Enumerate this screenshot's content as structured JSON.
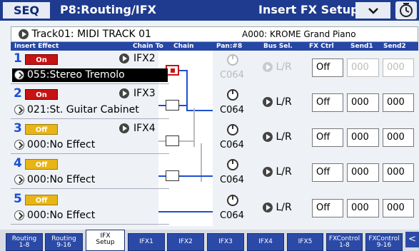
{
  "header": {
    "mode": "SEQ",
    "page_title": "P8:Routing/IFX",
    "page_menu": "Insert FX Setup",
    "menu_icon": "chevron-down-icon",
    "clock_icon": "clock-icon"
  },
  "track": {
    "name": "Track01: MIDI TRACK 01",
    "program": "A000: KROME Grand Piano"
  },
  "columns": {
    "insert_effect": "Insert Effect",
    "chain_to": "Chain To",
    "chain": "Chain",
    "pan": "Pan:#8",
    "bus_sel": "Bus Sel.",
    "fx_ctrl": "FX Ctrl",
    "send1": "Send1",
    "send2": "Send2"
  },
  "ifx_slots": [
    {
      "number": "1",
      "on_label": "On",
      "chain_to": "IFX2",
      "effect": "055:Stereo Tremolo",
      "pan": "C064",
      "bus": "L/R",
      "fx_ctrl": "Off",
      "send1": "000",
      "send2": "000"
    },
    {
      "number": "2",
      "on_label": "On",
      "chain_to": "IFX3",
      "effect": "021:St. Guitar Cabinet",
      "pan": "C064",
      "bus": "L/R",
      "fx_ctrl": "Off",
      "send1": "000",
      "send2": "000"
    },
    {
      "number": "3",
      "on_label": "Off",
      "chain_to": "IFX4",
      "effect": "000:No Effect",
      "pan": "C064",
      "bus": "L/R",
      "fx_ctrl": "Off",
      "send1": "000",
      "send2": "000"
    },
    {
      "number": "4",
      "on_label": "Off",
      "chain_to": "",
      "effect": "000:No Effect",
      "pan": "C064",
      "bus": "L/R",
      "fx_ctrl": "Off",
      "send1": "000",
      "send2": "000"
    },
    {
      "number": "5",
      "on_label": "Off",
      "chain_to": "",
      "effect": "000:No Effect",
      "pan": "C064",
      "bus": "L/R",
      "fx_ctrl": "Off",
      "send1": "000",
      "send2": "000"
    }
  ],
  "tabs": [
    {
      "line1": "Routing",
      "line2": "1-8"
    },
    {
      "line1": "Routing",
      "line2": "9-16"
    },
    {
      "line1": "IFX",
      "line2": "Setup"
    },
    {
      "line1": "IFX1",
      "line2": ""
    },
    {
      "line1": "IFX2",
      "line2": ""
    },
    {
      "line1": "IFX3",
      "line2": ""
    },
    {
      "line1": "IFX4",
      "line2": ""
    },
    {
      "line1": "IFX5",
      "line2": ""
    },
    {
      "line1": "FXControl",
      "line2": "1-8"
    },
    {
      "line1": "FXControl",
      "line2": "9-16"
    }
  ],
  "colors": {
    "title_bar": "#1f3b8f",
    "on_button": "#c61414",
    "off_button": "#e8b416",
    "slot_number": "#1d4fd0"
  }
}
